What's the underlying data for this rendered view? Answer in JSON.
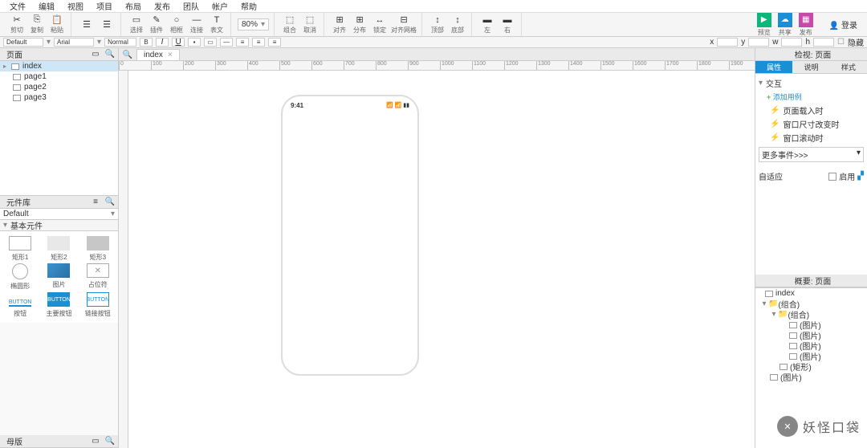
{
  "menu": [
    "文件",
    "编辑",
    "视图",
    "项目",
    "布局",
    "发布",
    "团队",
    "帐户",
    "帮助"
  ],
  "toolbar": {
    "groups": [
      [
        {
          "i": "✂",
          "l": "剪切"
        },
        {
          "i": "⎘",
          "l": "复制"
        },
        {
          "i": "📋",
          "l": "粘贴"
        }
      ],
      [
        {
          "i": "☰",
          "l": ""
        },
        {
          "i": "☰",
          "l": ""
        }
      ],
      [
        {
          "i": "▭",
          "l": "选择"
        },
        {
          "i": "✎",
          "l": "插件"
        },
        {
          "i": "○",
          "l": "相框"
        },
        {
          "i": "—",
          "l": "连接"
        },
        {
          "i": "T",
          "l": "表文"
        }
      ],
      [
        {
          "i": "⬚",
          "l": "组合"
        },
        {
          "i": "⬚",
          "l": "取消"
        }
      ],
      [
        {
          "i": "⊞",
          "l": "对齐"
        },
        {
          "i": "⊞",
          "l": "分布"
        },
        {
          "i": "↔",
          "l": "锁定"
        },
        {
          "i": "⊟",
          "l": "对齐网格"
        }
      ],
      [
        {
          "i": "↕",
          "l": "顶部"
        },
        {
          "i": "↕",
          "l": "底部"
        }
      ],
      [
        {
          "i": "▬",
          "l": "左"
        },
        {
          "i": "▬",
          "l": "右"
        }
      ]
    ],
    "zoom": "80%",
    "right": {
      "preview": "▶",
      "share": "☁",
      "play": "▦",
      "preview_l": "预览",
      "share_l": "共享",
      "play_l": "发布",
      "login": "登录"
    }
  },
  "prop": {
    "font_family": "Default",
    "font": "Arial",
    "size": "Normal",
    "x": "x",
    "y": "y",
    "w": "w",
    "h": "h",
    "hidden": "隐藏"
  },
  "pages": {
    "title": "页面",
    "root": "index",
    "items": [
      "page1",
      "page2",
      "page3"
    ]
  },
  "lib": {
    "title": "元件库",
    "sel": "Default",
    "cat": "基本元件",
    "items": [
      {
        "s": "rect",
        "l": "矩形1"
      },
      {
        "s": "rect2",
        "l": "矩形2"
      },
      {
        "s": "rect3",
        "l": "矩形3"
      },
      {
        "s": "circ",
        "l": "椭圆形"
      },
      {
        "s": "img",
        "l": "图片"
      },
      {
        "s": "ph",
        "l": "占位符"
      },
      {
        "s": "btn1",
        "l": "按钮",
        "t": "BUTTON"
      },
      {
        "s": "btn2",
        "l": "主要按钮",
        "t": "BUTTON"
      },
      {
        "s": "btn3",
        "l": "链接按钮",
        "t": "BUTTON"
      }
    ]
  },
  "master": {
    "title": "母版"
  },
  "tab": {
    "name": "index"
  },
  "ruler": [
    "0",
    "100",
    "200",
    "300",
    "400",
    "500",
    "600",
    "700",
    "800",
    "900",
    "1000",
    "1100",
    "1200",
    "1300",
    "1400",
    "1500",
    "1600",
    "1700",
    "1800",
    "1900"
  ],
  "phone": {
    "time": "9:41"
  },
  "inspector": {
    "title": "检视: 页面",
    "tabs": [
      "属性",
      "说明",
      "样式"
    ],
    "sec": "交互",
    "add": "添加用例",
    "events": [
      "页面载入时",
      "窗口尺寸改变时",
      "窗口滚动时"
    ],
    "more": "更多事件>>>",
    "adapt": "自适应",
    "use": "启用"
  },
  "outline": {
    "title": "概要: 页面",
    "root": "index",
    "group1": "(组合)",
    "group2": "(组合)",
    "items": [
      "(图片)",
      "(图片)",
      "(图片)",
      "(图片)"
    ],
    "rect": "(矩形)",
    "img": "(图片)"
  },
  "watermark": "妖怪口袋"
}
